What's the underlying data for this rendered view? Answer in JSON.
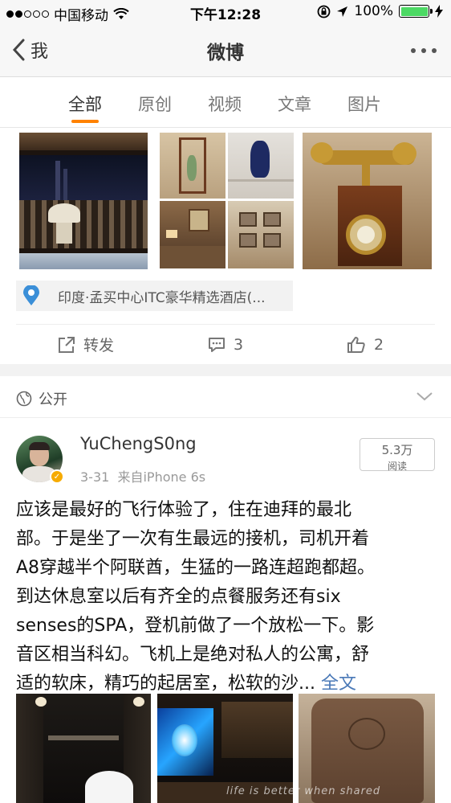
{
  "status_bar": {
    "carrier": "中国移动",
    "time": "下午12:28",
    "battery": "100%"
  },
  "nav": {
    "back_label": "我",
    "title": "微博"
  },
  "tabs": [
    {
      "label": "全部",
      "active": true
    },
    {
      "label": "原创",
      "active": false
    },
    {
      "label": "视频",
      "active": false
    },
    {
      "label": "文章",
      "active": false
    },
    {
      "label": "图片",
      "active": false
    }
  ],
  "post1": {
    "location": "印度·孟买中心ITC豪华精选酒店(...",
    "repost_label": "转发",
    "comment_count": "3",
    "like_count": "2"
  },
  "visibility": {
    "label": "公开"
  },
  "post2": {
    "username": "YuChengS0ng",
    "date": "3-31",
    "source": "来自iPhone 6s",
    "reads_count": "5.3万",
    "reads_label": "阅读",
    "text": "应该是最好的飞行体验了，住在迪拜的最北\n部。于是坐了一次有生最远的接机，司机开着\nA8穿越半个阿联酋，生猛的一路连超跑都超。\n到达休息室以后有齐全的点餐服务还有six\nsenses的SPA，登机前做了一个放松一下。影\n音区相当科幻。飞机上是绝对私人的公寓，舒\n适的软床，精巧的起居室，松软的沙...",
    "full_text_link": "全文",
    "watermark": "life is better when shared"
  },
  "colors": {
    "accent": "#ff8200",
    "link": "#4a79b7",
    "battery": "#4cd964",
    "verified": "#f6ab00"
  }
}
